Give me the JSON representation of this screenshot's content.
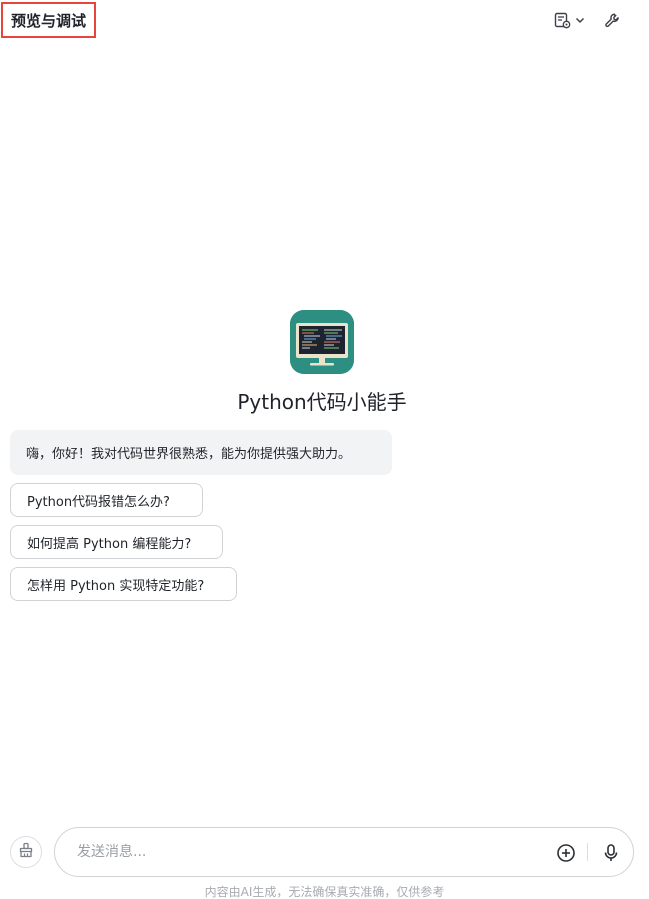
{
  "header": {
    "title": "预览与调试",
    "icons": {
      "layout": "document-settings-icon",
      "dropdown": "chevron-down-icon",
      "tools": "wrench-icon"
    }
  },
  "bot": {
    "name": "Python代码小能手",
    "avatar_icon": "code-monitor-icon",
    "greeting": "嗨，你好！我对代码世界很熟悉，能为你提供强大助力。"
  },
  "suggestions": [
    "Python代码报错怎么办?",
    "如何提高 Python 编程能力?",
    "怎样用 Python 实现特定功能?"
  ],
  "composer": {
    "placeholder": "发送消息...",
    "icons": {
      "clear": "broom-icon",
      "add": "plus-circle-icon",
      "voice": "microphone-icon"
    }
  },
  "footer": {
    "disclaimer": "内容由AI生成，无法确保真实准确，仅供参考"
  },
  "colors": {
    "title_highlight": "#e5453b",
    "avatar_bg": "#2c8f82",
    "greeting_bg": "#f2f3f5"
  }
}
